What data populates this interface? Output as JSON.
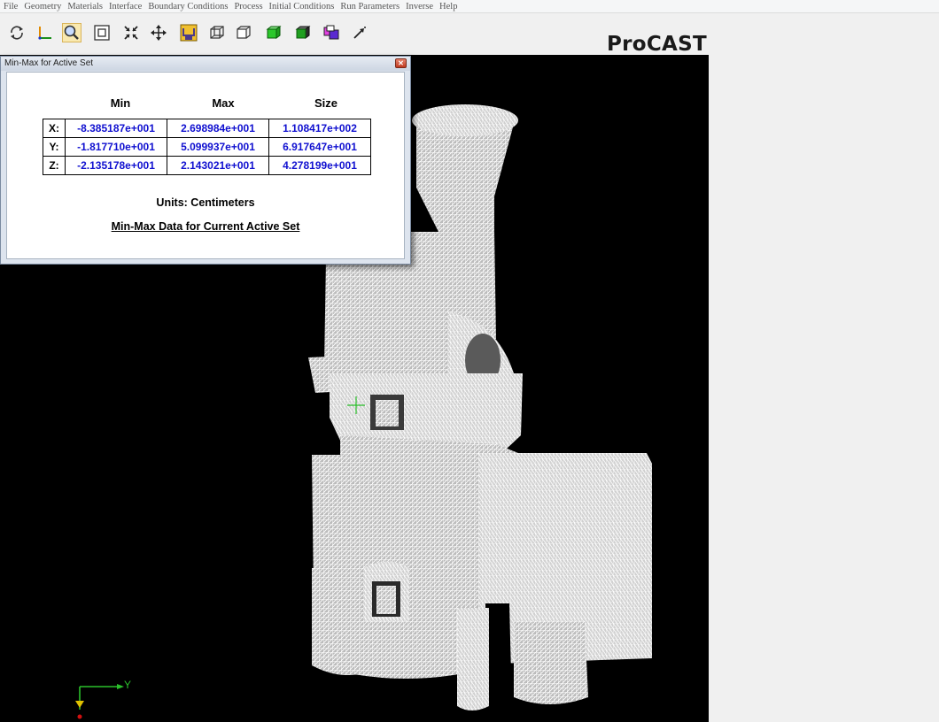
{
  "menu": [
    "File",
    "Geometry",
    "Materials",
    "Interface",
    "Boundary Conditions",
    "Process",
    "Initial Conditions",
    "Run Parameters",
    "Inverse",
    "Help"
  ],
  "toolbar": {
    "icons": [
      "rotate-icon",
      "axis-icon",
      "zoom-icon",
      "zoom-box-icon",
      "fit-icon",
      "pan-icon",
      "select-icon",
      "wireframe-icon",
      "hidden-line-icon",
      "shaded-icon",
      "solid-icon",
      "color-icon",
      "pointer-icon"
    ],
    "active": "zoom-icon"
  },
  "brand": "ProCAST",
  "dialog": {
    "title": "Min-Max for Active Set",
    "headers": [
      "Min",
      "Max",
      "Size"
    ],
    "rows": [
      {
        "axis": "X:",
        "min": "-8.385187e+001",
        "max": "2.698984e+001",
        "size": "1.108417e+002"
      },
      {
        "axis": "Y:",
        "min": "-1.817710e+001",
        "max": "5.099937e+001",
        "size": "6.917647e+001"
      },
      {
        "axis": "Z:",
        "min": "-2.135178e+001",
        "max": "2.143021e+001",
        "size": "4.278199e+001"
      }
    ],
    "units": "Units: Centimeters",
    "footer": "Min-Max Data for Current Active Set"
  },
  "triad": {
    "y_label": "Y"
  },
  "colors": {
    "background": "#000000",
    "mesh": "#ffffff",
    "value": "#1010d0",
    "triad_x": "#00c000",
    "triad_y": "#00c000"
  }
}
